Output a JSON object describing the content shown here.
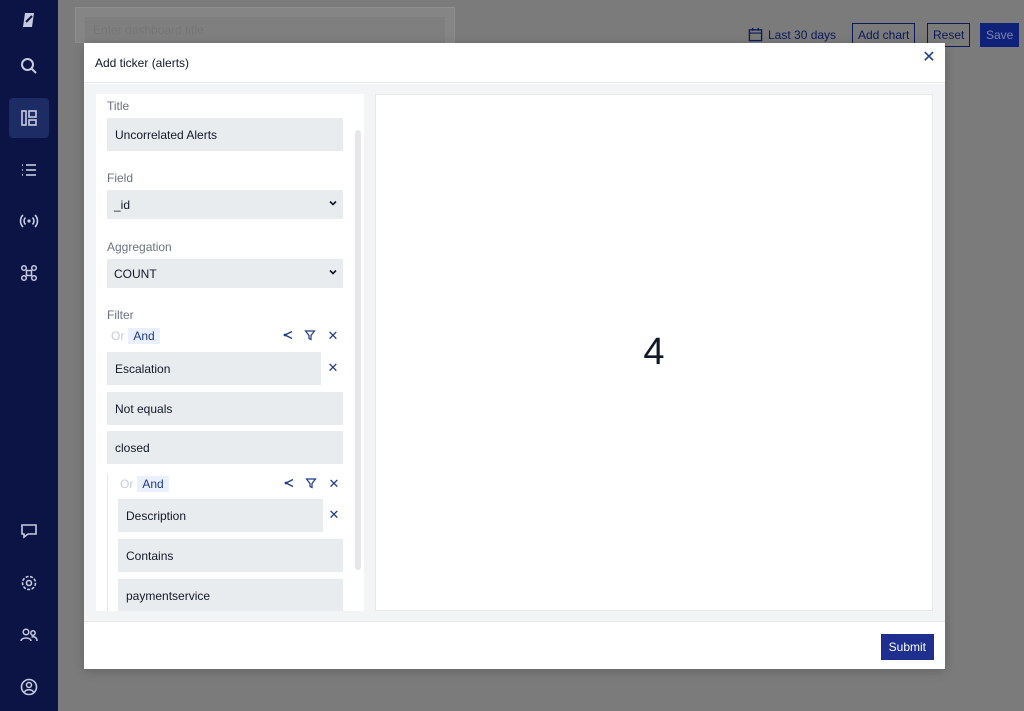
{
  "background": {
    "dashboard_title_placeholder": "Enter dashboard title",
    "date_range": "Last 30 days",
    "add_chart_label": "Add chart",
    "reset_label": "Reset",
    "save_label": "Save"
  },
  "sidebar": {
    "icons": [
      "logo-icon",
      "search-icon",
      "dashboard-icon",
      "list-icon",
      "signal-icon",
      "integrations-icon",
      "chat-icon",
      "settings-icon",
      "users-icon",
      "account-icon"
    ],
    "active": "dashboard-icon"
  },
  "modal": {
    "title": "Add ticker (alerts)",
    "submit_label": "Submit",
    "form": {
      "title_label": "Title",
      "title_value": "Uncorrelated Alerts",
      "field_label": "Field",
      "field_value": "_id",
      "aggregation_label": "Aggregation",
      "aggregation_value": "COUNT",
      "filter_label": "Filter",
      "or_label": "Or",
      "and_label": "And",
      "condition1": {
        "field": "Escalation",
        "operator": "Not equals",
        "value": "closed"
      },
      "nested_or_label": "Or",
      "nested_and_label": "And",
      "condition2": {
        "field": "Description",
        "operator": "Contains",
        "value": "paymentservice"
      }
    },
    "preview_value": "4"
  },
  "colors": {
    "sidebar": "#0c1445",
    "primary": "#1e2f8f",
    "accent": "#1e3a8a"
  }
}
